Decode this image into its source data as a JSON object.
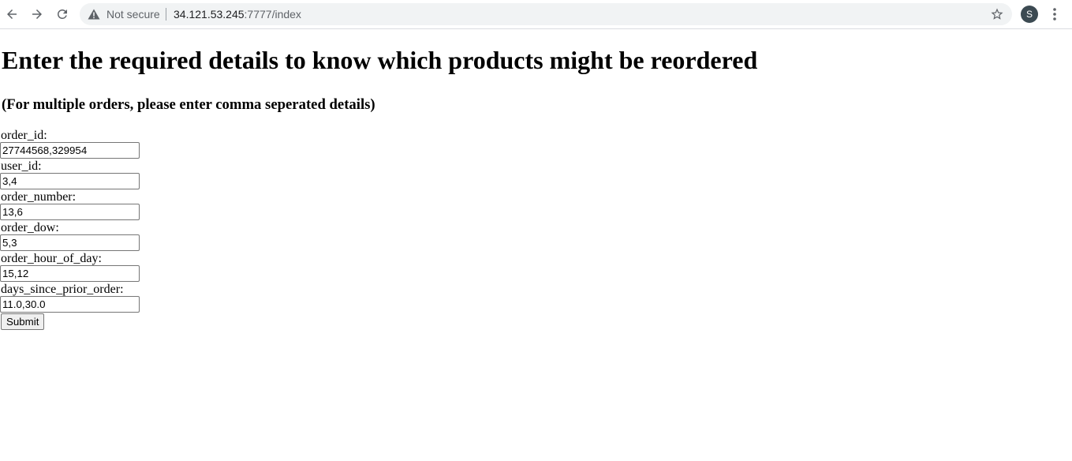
{
  "browser": {
    "security_label": "Not secure",
    "url_host": "34.121.53.245",
    "url_rest": ":7777/index",
    "avatar_letter": "S",
    "icons": {
      "back": "back-arrow-icon",
      "forward": "forward-arrow-icon",
      "reload": "reload-icon",
      "security": "warning-triangle-icon",
      "bookmark": "star-icon",
      "menu": "vertical-dots-icon"
    }
  },
  "page": {
    "heading": "Enter the required details to know which products might be reordered",
    "subheading": "(For multiple orders, please enter comma seperated details)",
    "fields": [
      {
        "label": "order_id:",
        "value": "27744568,329954"
      },
      {
        "label": "user_id:",
        "value": "3,4"
      },
      {
        "label": "order_number:",
        "value": "13,6"
      },
      {
        "label": "order_dow:",
        "value": "5,3"
      },
      {
        "label": "order_hour_of_day:",
        "value": "15,12"
      },
      {
        "label": "days_since_prior_order:",
        "value": "11.0,30.0"
      }
    ],
    "submit_label": "Submit"
  }
}
